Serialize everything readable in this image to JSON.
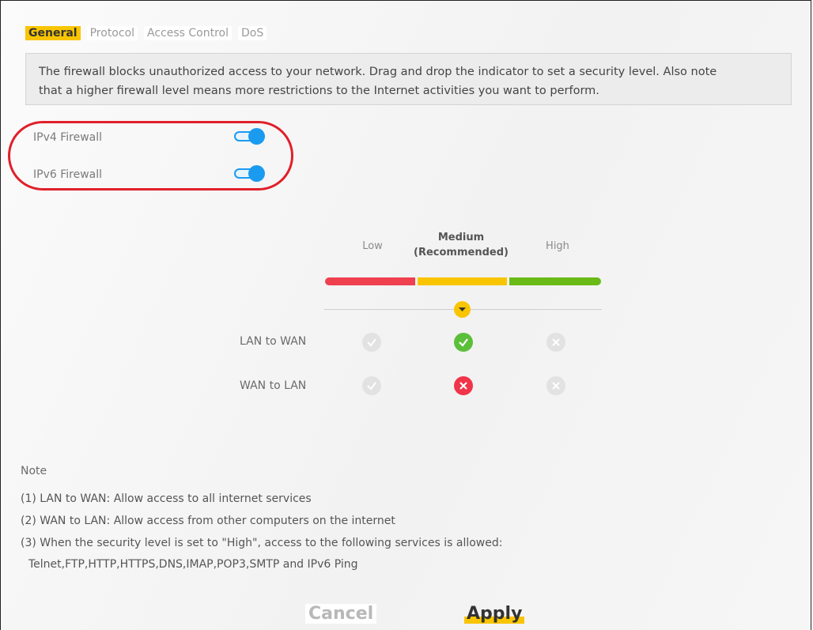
{
  "tabs": [
    {
      "label": "General",
      "active": true
    },
    {
      "label": "Protocol",
      "active": false
    },
    {
      "label": "Access Control",
      "active": false
    },
    {
      "label": "DoS",
      "active": false
    }
  ],
  "description": {
    "line1": "The firewall blocks unauthorized access to your network. Drag and drop the indicator to set a security level. Also note",
    "line2": "that a higher firewall level means more restrictions to the Internet activities you want to perform."
  },
  "firewall": {
    "ipv4_label": "IPv4 Firewall",
    "ipv4_enabled": true,
    "ipv6_label": "IPv6 Firewall",
    "ipv6_enabled": true
  },
  "security_level": {
    "low": "Low",
    "medium_line1": "Medium",
    "medium_line2": "(Recommended)",
    "high": "High",
    "selected": "Medium",
    "colors": {
      "low": "#ef4050",
      "medium": "#f9c500",
      "high": "#6aba17"
    }
  },
  "traffic_rows": [
    {
      "label": "LAN to WAN",
      "low": "check-disabled",
      "medium": "check-allowed",
      "high": "cross-disabled"
    },
    {
      "label": "WAN to LAN",
      "low": "check-disabled",
      "medium": "cross-blocked",
      "high": "cross-disabled"
    }
  ],
  "notes": {
    "title": "Note",
    "n1": "(1) LAN to WAN: Allow access to all internet services",
    "n2": "(2) WAN to LAN: Allow access from other computers on the internet",
    "n3": "(3) When the security level is set to \"High\", access to the following services is allowed:",
    "n3_services": "Telnet,FTP,HTTP,HTTPS,DNS,IMAP,POP3,SMTP and IPv6 Ping"
  },
  "buttons": {
    "cancel": "Cancel",
    "apply": "Apply"
  }
}
